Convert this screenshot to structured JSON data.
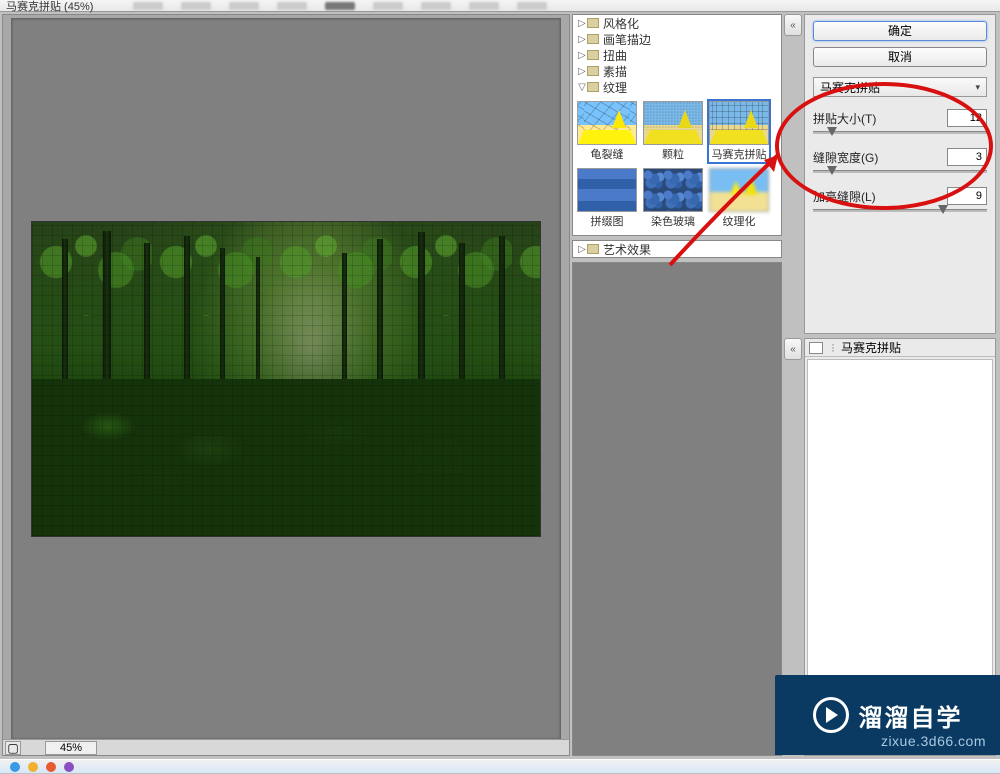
{
  "window": {
    "title": "马赛克拼贴 (45%)"
  },
  "zoom": "45%",
  "folders": [
    {
      "label": "风格化",
      "expanded": false
    },
    {
      "label": "画笔描边",
      "expanded": false
    },
    {
      "label": "扭曲",
      "expanded": false
    },
    {
      "label": "素描",
      "expanded": false
    },
    {
      "label": "纹理",
      "expanded": true
    },
    {
      "label": "艺术效果",
      "expanded": false
    }
  ],
  "thumbs": [
    {
      "label": "龟裂缝"
    },
    {
      "label": "颗粒"
    },
    {
      "label": "马赛克拼贴",
      "selected": true
    },
    {
      "label": "拼缀图"
    },
    {
      "label": "染色玻璃"
    },
    {
      "label": "纹理化"
    }
  ],
  "buttons": {
    "ok": "确定",
    "cancel": "取消"
  },
  "filter_select": "马赛克拼贴",
  "params": {
    "tile_size": {
      "label": "拼贴大小(T)",
      "value": "12",
      "pos": 8
    },
    "grout_width": {
      "label": "缝隙宽度(G)",
      "value": "3",
      "pos": 8
    },
    "lighten_grout": {
      "label": "加亮缝隙(L)",
      "value": "9",
      "pos": 72
    }
  },
  "history": {
    "title": "马赛克拼贴"
  },
  "watermark": {
    "text": "溜溜自学",
    "url": "zixue.3d66.com"
  },
  "colors": {
    "accent": "#3874d6",
    "annot": "#d81010",
    "brand": "#0a3a62"
  }
}
